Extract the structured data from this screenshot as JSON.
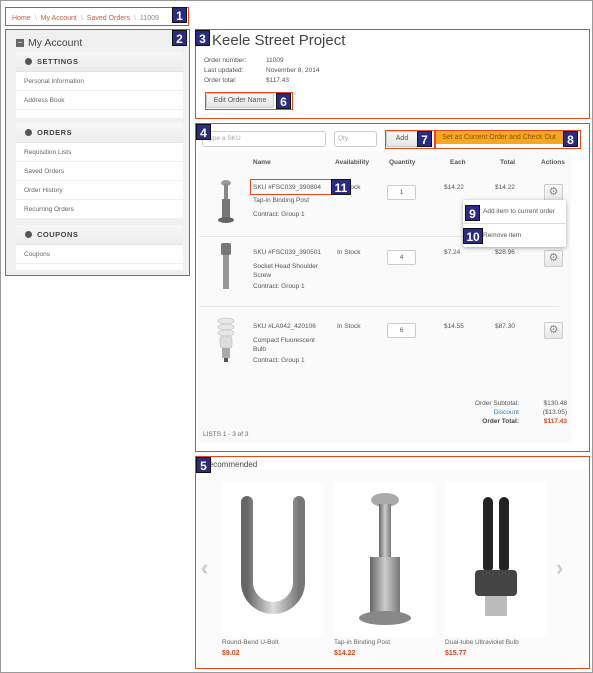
{
  "breadcrumb": {
    "items": [
      "Home",
      "My Account",
      "Saved Orders"
    ],
    "current": "11009"
  },
  "badges": [
    "1",
    "2",
    "3",
    "4",
    "5",
    "6",
    "7",
    "8",
    "9",
    "10",
    "11"
  ],
  "sidebar": {
    "title": "My Account",
    "groups": [
      {
        "label": "SETTINGS",
        "items": [
          "Personal Information",
          "Address Book"
        ]
      },
      {
        "label": "ORDERS",
        "items": [
          "Requisition Lists",
          "Saved Orders",
          "Order History",
          "Recurring Orders"
        ]
      },
      {
        "label": "COUPONS",
        "items": [
          "Coupons"
        ]
      }
    ]
  },
  "order": {
    "title": "Keele Street Project",
    "meta": [
      {
        "label": "Order number:",
        "value": "11009"
      },
      {
        "label": "Last updated:",
        "value": "November 8, 2014"
      },
      {
        "label": "Order total:",
        "value": "$117.43"
      }
    ],
    "edit_button": "Edit Order Name"
  },
  "toolbar": {
    "sku_placeholder": "Type a SKU",
    "qty_placeholder": "Qty",
    "add_button": "Add",
    "checkout_button": "Set as Current Order and Check Out"
  },
  "table": {
    "headers": [
      "Name",
      "Availability",
      "Quantity",
      "Each",
      "Total",
      "Actions"
    ],
    "rows": [
      {
        "sku": "SKU #FSC039_390804",
        "name": "Tap-in Binding Post",
        "contract": "Contract:  Group 1",
        "availability": "In Stock",
        "quantity": "1",
        "each": "$14.22",
        "total": "$14.22"
      },
      {
        "sku": "SKU #FSC039_390501",
        "name": "Socket Head Shoulder Screw",
        "contract": "Contract:  Group 1",
        "availability": "In Stock",
        "quantity": "4",
        "each": "$7.24",
        "total": "$28.96"
      },
      {
        "sku": "SKU #LA042_420106",
        "name": "Compact Fluorescent Bulb",
        "contract": "Contract:  Group 1",
        "availability": "In Stock",
        "quantity": "6",
        "each": "$14.55",
        "total": "$87.30"
      }
    ],
    "action_menu": [
      "Add item to current order",
      "Remove item"
    ],
    "summary": {
      "subtotal_label": "Order Subtotal:",
      "subtotal": "$130.48",
      "discount_label": "Discount",
      "discount": "($13.05)",
      "total_label": "Order Total:",
      "total": "$117.43"
    },
    "pagination": "LISTS 1 - 3 of 3"
  },
  "recommended": {
    "title": "Recommended",
    "items": [
      {
        "name": "Round-Bend U-Bolt",
        "price": "$9.02"
      },
      {
        "name": "Tap-in Binding Post",
        "price": "$14.22"
      },
      {
        "name": "Dual-tube Ultraviolet Bulb",
        "price": "$15.77"
      }
    ]
  },
  "colors": {
    "annotation": "#e8461c",
    "badge": "#2b2a85",
    "accent_orange": "#f5a623",
    "price": "#d0471b",
    "link": "#2a7fc6"
  }
}
